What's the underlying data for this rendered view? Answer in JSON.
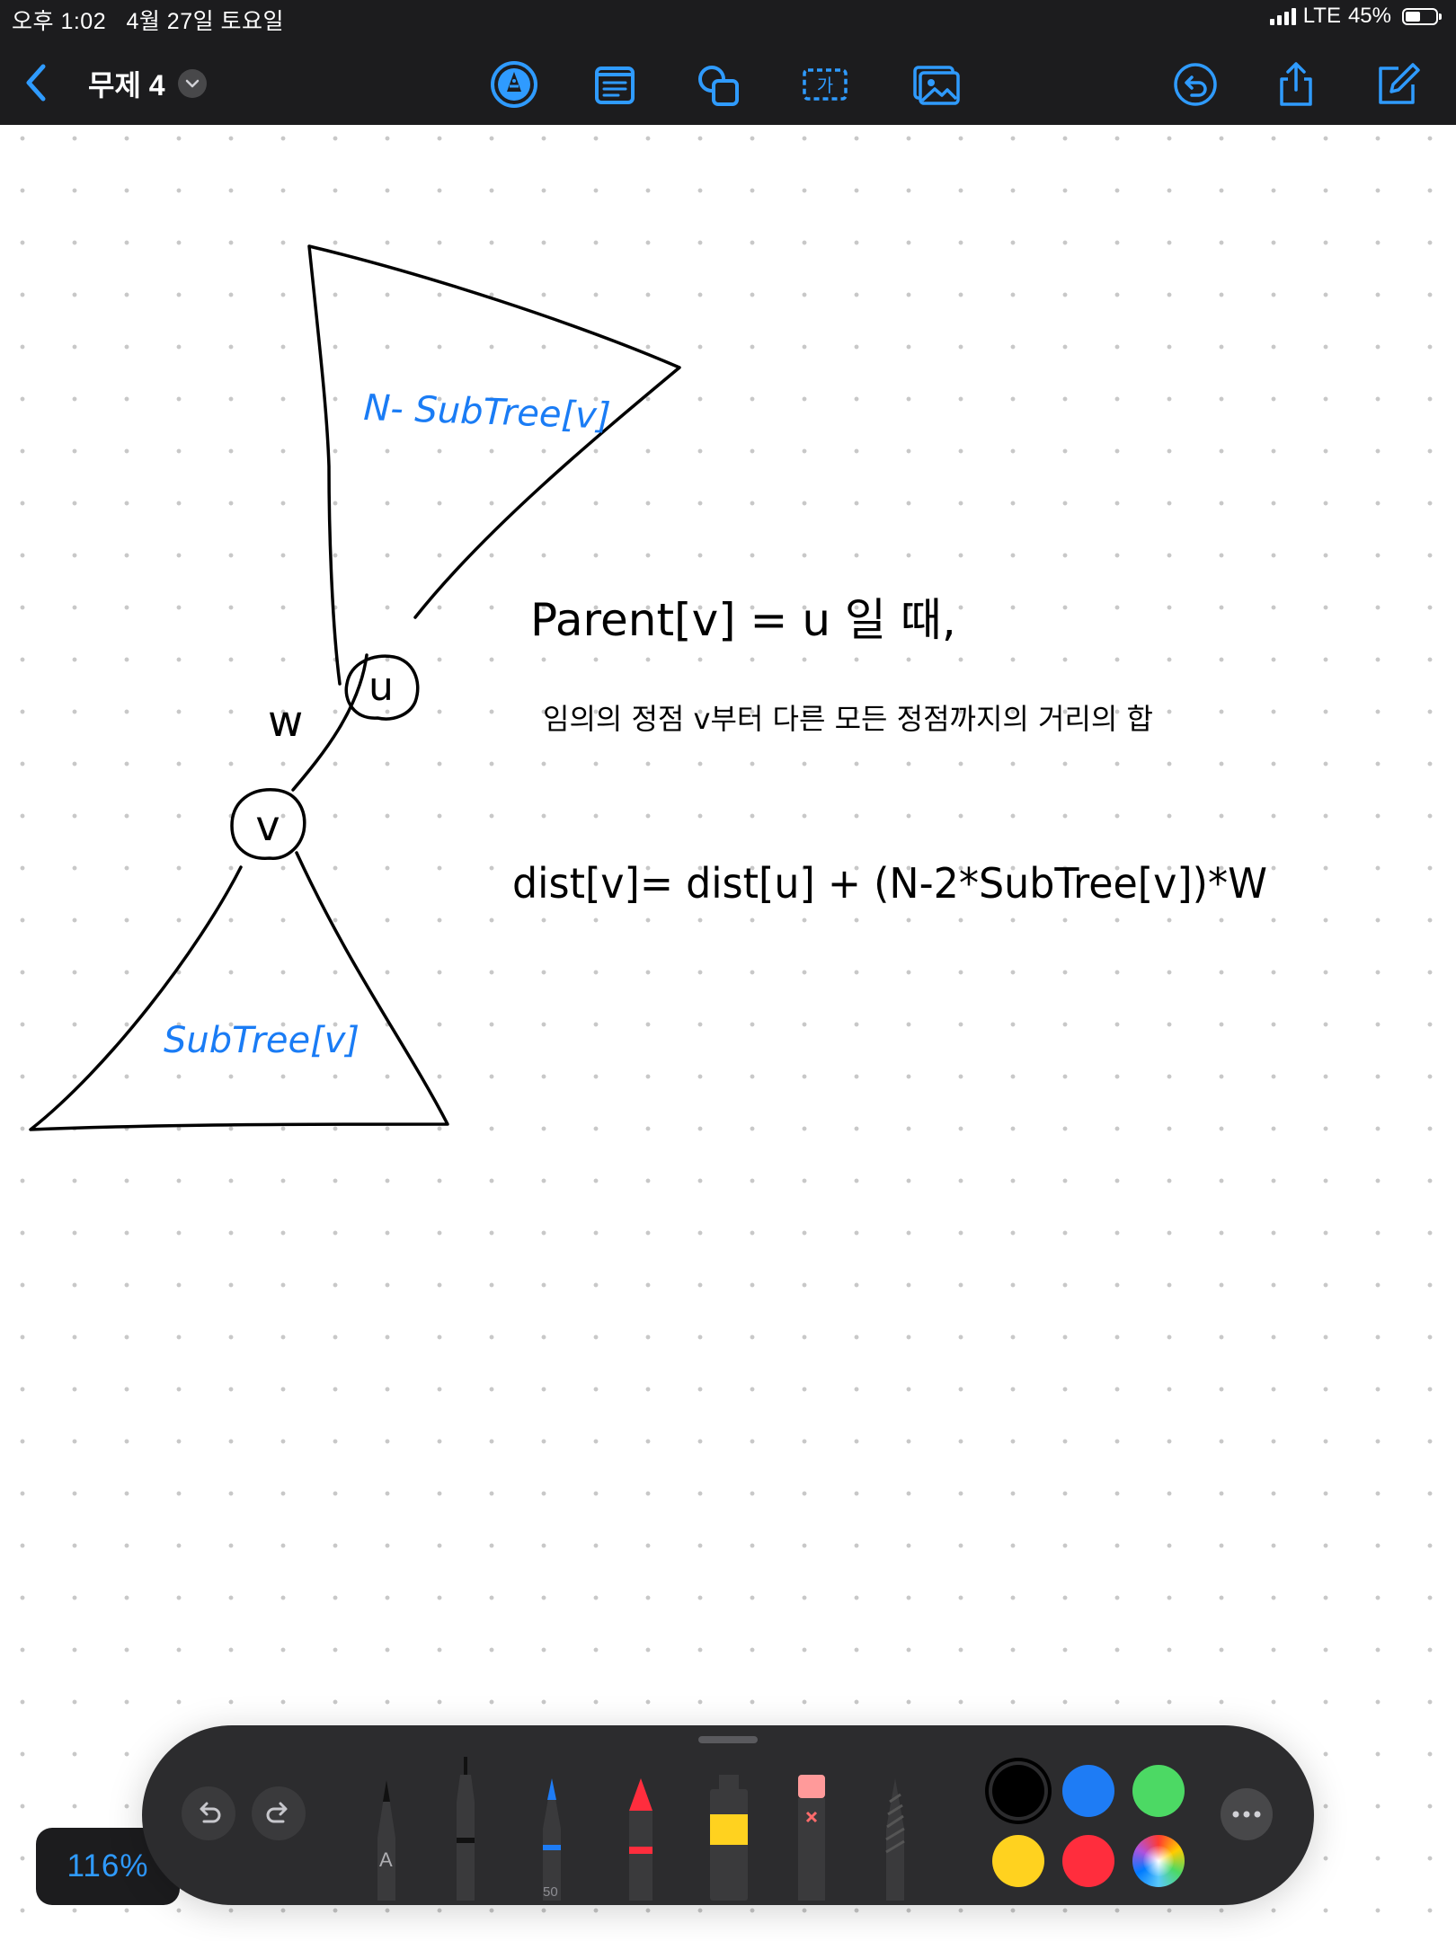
{
  "status_bar": {
    "time": "오후 1:02",
    "date": "4월 27일 토요일",
    "network": "LTE",
    "battery": "45%"
  },
  "toolbar": {
    "title": "무제 4",
    "icons": [
      "back-chevron",
      "pen-markup",
      "text-box",
      "shapes",
      "text-insert",
      "media",
      "undo-history",
      "share",
      "new-note"
    ]
  },
  "canvas": {
    "top_triangle_label": "N- SubTree[v]",
    "node_u": "u",
    "edge_weight": "w",
    "node_v": "v",
    "bottom_triangle_label": "SubTree[v]",
    "note_line1": "Parent[v] = u 일 때,",
    "note_line2": "임의의 정점 v부터 다른 모든 정점까지의 거리의 합",
    "formula": "dist[v]= dist[u] + (N-2*SubTree[v])*W",
    "ink_color": "#000000",
    "label_color": "#1a7cf5"
  },
  "palette": {
    "zoom": "116%",
    "pencil_letter": "A",
    "pen_width": "50",
    "colors": [
      "#000000",
      "#1e7cf5",
      "#4cd964",
      "#ffd21f",
      "#ff2d3d",
      "rainbow"
    ],
    "selected_color": "#000000"
  }
}
